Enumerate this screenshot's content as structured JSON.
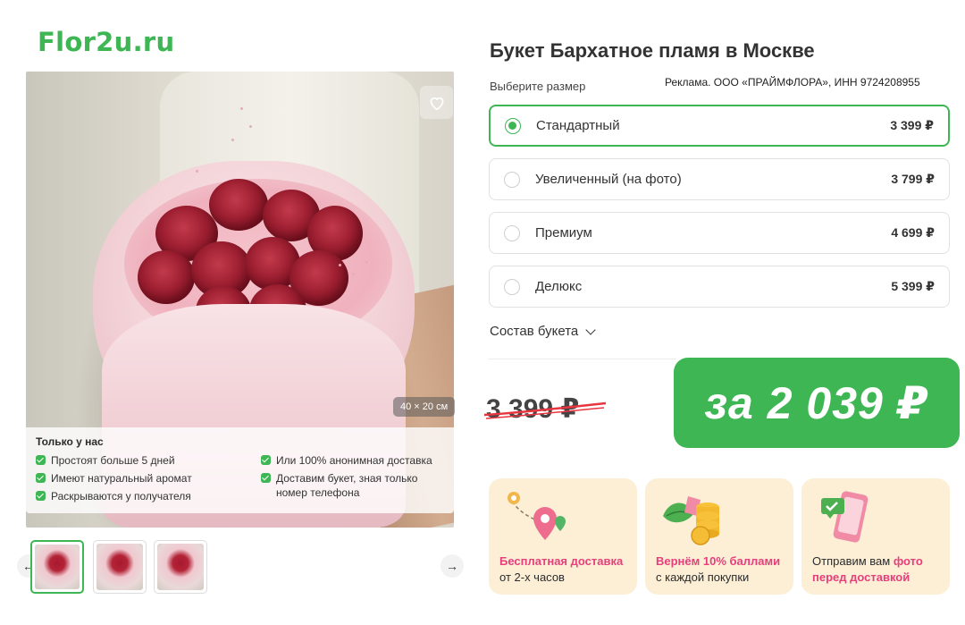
{
  "logo": "Flor2u.ru",
  "product": {
    "title": "Букет Бархатное пламя в Москве",
    "choose_size_label": "Выберите размер",
    "ad_notice": "Реклама. ООО «ПРАЙМФЛОРА», ИНН 9724208955"
  },
  "size_options": [
    {
      "label": "Стандартный",
      "price": "3 399 ₽",
      "selected": true
    },
    {
      "label": "Увеличенный (на фото)",
      "price": "3 799 ₽",
      "selected": false
    },
    {
      "label": "Премиум",
      "price": "4 699 ₽",
      "selected": false
    },
    {
      "label": "Делюкс",
      "price": "5 399 ₽",
      "selected": false
    }
  ],
  "composition_label": "Состав букета",
  "pricing": {
    "old_price": "3 399 ₽",
    "deal_price": "за 2 039 ₽"
  },
  "gallery": {
    "size_tag": "40 × 20 см",
    "thumbnails_count": 3,
    "active_thumbnail": 1
  },
  "only_us": {
    "title": "Только у нас",
    "left": [
      "Простоят больше 5 дней",
      "Имеют натуральный аромат",
      "Раскрываются у получателя"
    ],
    "right": [
      "Или 100% анонимная доставка",
      "Доставим букет, зная только номер телефона"
    ]
  },
  "perks": [
    {
      "highlight": "Бесплатная доставка",
      "text": "от 2-х часов",
      "icon": "map-pin-icon"
    },
    {
      "highlight": "Вернём 10% баллами",
      "text": "с каждой покупки",
      "icon": "coins-icon"
    },
    {
      "prefix": "Отправим вам ",
      "highlight_inline": "фото",
      "highlight": "перед доставкой",
      "icon": "phone-photo-icon"
    }
  ],
  "colors": {
    "brand_green": "#3db653",
    "accent_pink": "#e73e7c",
    "perk_bg": "#fcefd6"
  }
}
